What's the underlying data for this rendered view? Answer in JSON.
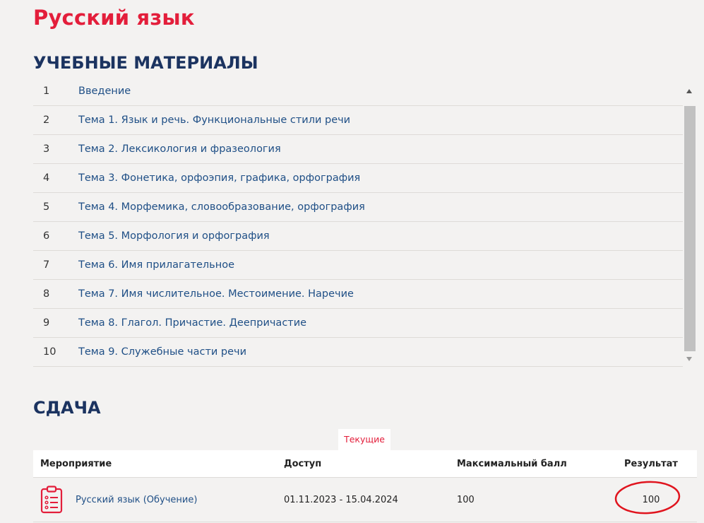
{
  "page": {
    "title": "Русский язык"
  },
  "materials": {
    "title": "УЧЕБНЫЕ МАТЕРИАЛЫ",
    "items": [
      {
        "num": "1",
        "title": "Введение"
      },
      {
        "num": "2",
        "title": "Тема 1. Язык и речь. Функциональные стили речи"
      },
      {
        "num": "3",
        "title": "Тема 2. Лексикология и фразеология"
      },
      {
        "num": "4",
        "title": "Тема 3. Фонетика, орфоэпия, графика, орфография"
      },
      {
        "num": "5",
        "title": "Тема 4. Морфемика, словообразование, орфография"
      },
      {
        "num": "6",
        "title": "Тема 5. Морфология и орфография"
      },
      {
        "num": "7",
        "title": "Тема 6. Имя прилагательное"
      },
      {
        "num": "8",
        "title": "Тема 7. Имя числительное. Местоимение. Наречие"
      },
      {
        "num": "9",
        "title": "Тема 8. Глагол. Причастие. Деепричастие"
      },
      {
        "num": "10",
        "title": "Тема 9. Служебные части речи"
      }
    ]
  },
  "submission": {
    "title": "СДАЧА",
    "tab_current": "Текущие",
    "columns": {
      "event": "Мероприятие",
      "access": "Доступ",
      "max_score": "Максимальный балл",
      "result": "Результат"
    },
    "rows": [
      {
        "event": "Русский язык (Обучение)",
        "access": "01.11.2023 - 15.04.2024",
        "max_score": "100",
        "result": "100"
      }
    ]
  },
  "icons": {
    "event_icon": "clipboard-list-icon",
    "scroll_up": "triangle-up-icon",
    "scroll_down": "triangle-down-icon"
  },
  "colors": {
    "accent": "#e31e3b",
    "heading": "#1b3360",
    "link": "#1f4f86",
    "background": "#f3f2f1"
  }
}
